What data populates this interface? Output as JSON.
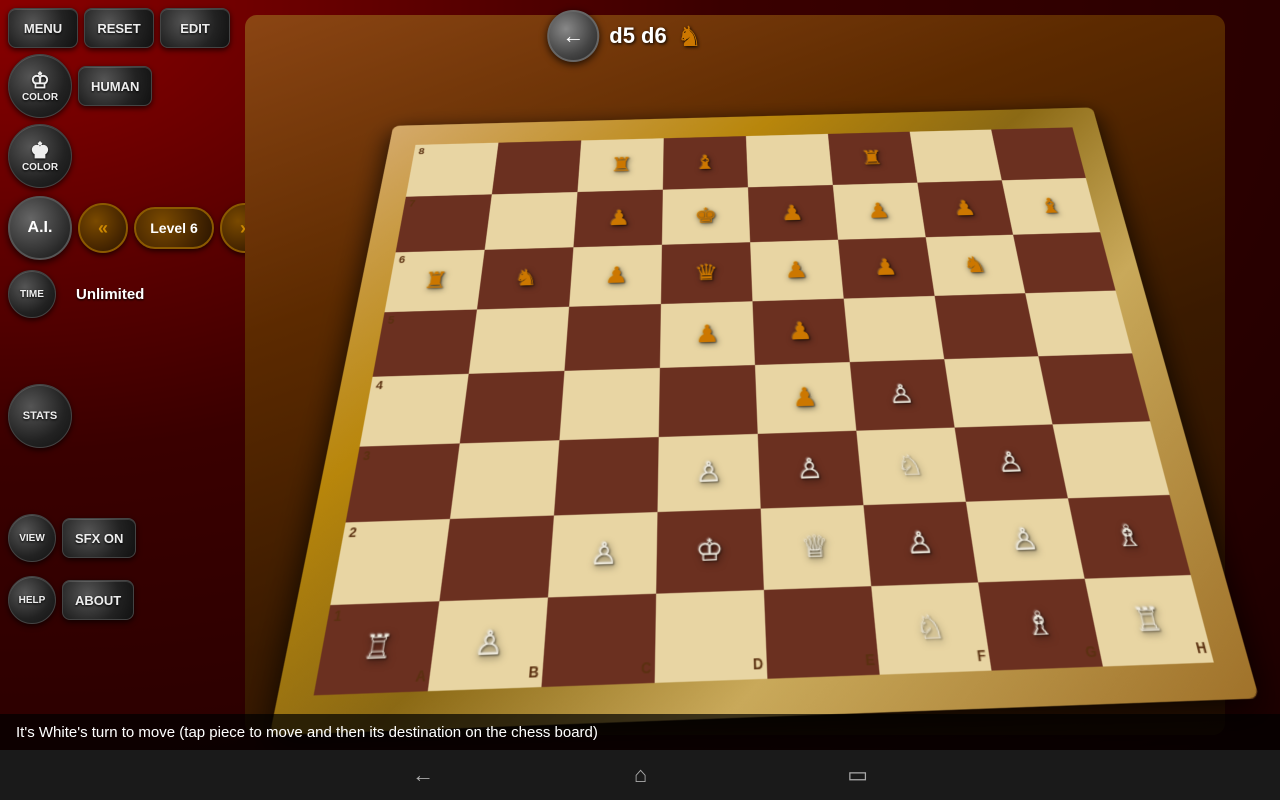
{
  "toolbar": {
    "menu_label": "MENU",
    "reset_label": "RESET",
    "edit_label": "EDIT"
  },
  "player1": {
    "color_label": "COLOR",
    "type_label": "HUMAN"
  },
  "player2": {
    "color_label": "COLOR",
    "ai_label": "A.I.",
    "prev_label": "«",
    "level_label": "Level 6",
    "next_label": "»"
  },
  "time": {
    "label": "TIME",
    "value": "Unlimited"
  },
  "stats": {
    "label": "STATS"
  },
  "view": {
    "label": "VIEW",
    "sfx_label": "SFX ON"
  },
  "help": {
    "label": "HELP",
    "about_label": "ABOUT"
  },
  "move": {
    "back_arrow": "←",
    "notation": "d5 d6"
  },
  "status": {
    "message": "It's White's turn to move (tap piece to move and then its destination on the chess board)"
  },
  "nav": {
    "back_icon": "←",
    "home_icon": "⌂",
    "recents_icon": "▭"
  },
  "board": {
    "cols": [
      "A",
      "B",
      "C",
      "D",
      "E",
      "F",
      "G",
      "H"
    ],
    "rows": [
      "8",
      "7",
      "6",
      "5",
      "4",
      "3",
      "2",
      "1"
    ]
  }
}
